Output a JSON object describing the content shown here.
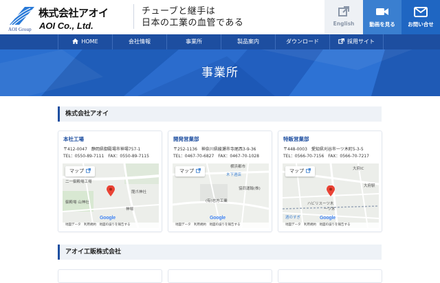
{
  "header": {
    "logo_group": "AOI Group",
    "logo_jp": "株式会社アオイ",
    "logo_en": "AOI Co., Ltd.",
    "tagline_line1": "チューブと継手は",
    "tagline_line2": "日本の工業の血管である",
    "buttons": [
      {
        "label": "English",
        "icon": "external-link-icon"
      },
      {
        "label": "動画を見る",
        "icon": "video-camera-icon"
      },
      {
        "label": "お問い合せ",
        "icon": "mail-icon"
      }
    ]
  },
  "nav": {
    "items": [
      {
        "label": "HOME",
        "icon": "home-icon"
      },
      {
        "label": "会社情報"
      },
      {
        "label": "事業所"
      },
      {
        "label": "製品案内"
      },
      {
        "label": "ダウンロード"
      },
      {
        "label": "採用サイト",
        "icon": "external-link-icon"
      }
    ]
  },
  "hero": {
    "title": "事業所"
  },
  "sections": [
    {
      "title": "株式会社アオイ",
      "offices": [
        {
          "name": "本社工場",
          "address": "〒412-0047　静岡県御殿場市神場757-1",
          "tel": "TEL：0550-89-7111　FAX：0550-89-7115",
          "map": {
            "link_label": "マップ",
            "labels": [
              "二一御殿場工場",
              "御殿場 山神社",
              "神場",
              "龍爪神社"
            ],
            "google": "Google",
            "footer": "地図データ　利用規約　地図の誤りを報告する"
          }
        },
        {
          "name": "開発営業部",
          "address": "〒252-1136　神奈川県綾瀬市寺尾西3-9-36",
          "tel": "TEL：0467-70-6827　FAX：0467-70-1028",
          "map": {
            "link_label": "マップ",
            "labels": [
              "横浜都市",
              "木下酒店",
              "協同運輸(株)",
              "(有)志方工業"
            ],
            "google": "Google",
            "footer": "地図データ　利用規約　地図の誤りを報告する"
          }
        },
        {
          "name": "特販営業部",
          "address": "〒448-0003　愛知県刈谷市一ツ木町5-3-5",
          "tel": "TEL：0566-70-7156　FAX：0566-70-7217",
          "map": {
            "link_label": "マップ",
            "labels": [
              "大府IC",
              "大府駅",
              "ハビリスーツ木",
              "一ツ木",
              "酒のすぎ"
            ],
            "google": "Google",
            "footer": "地図データ　利用規約　地図の誤りを報告する"
          }
        }
      ]
    },
    {
      "title": "アオイ工販株式会社"
    }
  ],
  "colors": {
    "brand_blue": "#1d4ea0",
    "hero_blue": "#2464c4",
    "link_blue": "#1d4ea0",
    "pin_red": "#ea4335"
  }
}
